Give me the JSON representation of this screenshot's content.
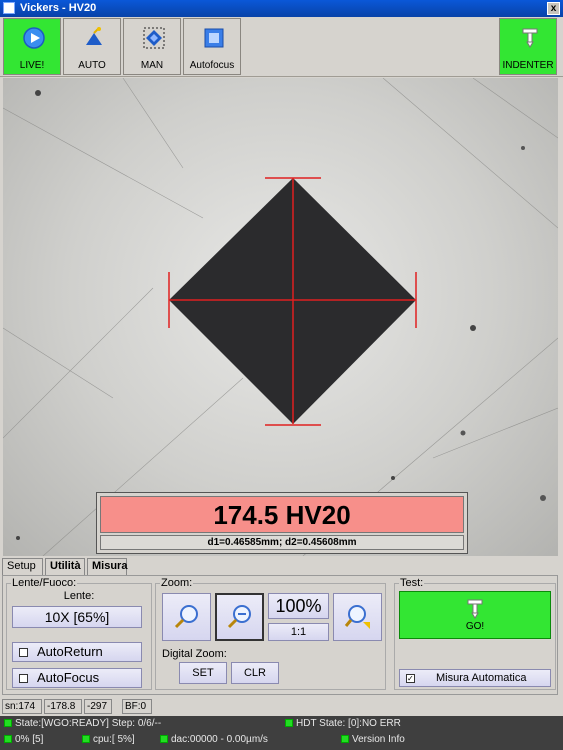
{
  "window": {
    "title": "Vickers - HV20",
    "close": "x"
  },
  "toolbar": {
    "live": "LIVE!",
    "auto": "AUTO",
    "man": "MAN",
    "autofocus": "Autofocus",
    "indenter": "INDENTER"
  },
  "result": {
    "hardness": "174.5 HV20",
    "diagonals": "d1=0.46585mm; d2=0.45608mm"
  },
  "tabs": [
    "Setup",
    "Utilità",
    "Misura"
  ],
  "lens": {
    "group_label": "Lente/Fuoco:",
    "lens_label": "Lente:",
    "lens_value": "10X [65%]",
    "autoreturn": "AutoReturn",
    "autofocus": "AutoFocus"
  },
  "zoom": {
    "group_label": "Zoom:",
    "percent": "100%",
    "ratio": "1:1",
    "digital_label": "Digital Zoom:",
    "set": "SET",
    "clr": "CLR"
  },
  "test": {
    "group_label": "Test:",
    "go": "GO!",
    "auto_measure": "Misura Automatica"
  },
  "status": {
    "sn": "sn:174",
    "x": "-178.8",
    "y": "-297",
    "bf": "BF:0"
  },
  "info": {
    "state": "State:[WGO:READY] Step: 0/6/--",
    "hdt": "HDT State: [0]:NO ERR",
    "progress": "0% [5]",
    "cpu": "cpu:[ 5%]",
    "dac": "dac:00000 - 0.00µm/s",
    "version": "Version Info"
  },
  "colors": {
    "green": "#33e633",
    "result_bg": "#f78f8a",
    "measure_line": "#e02020"
  }
}
